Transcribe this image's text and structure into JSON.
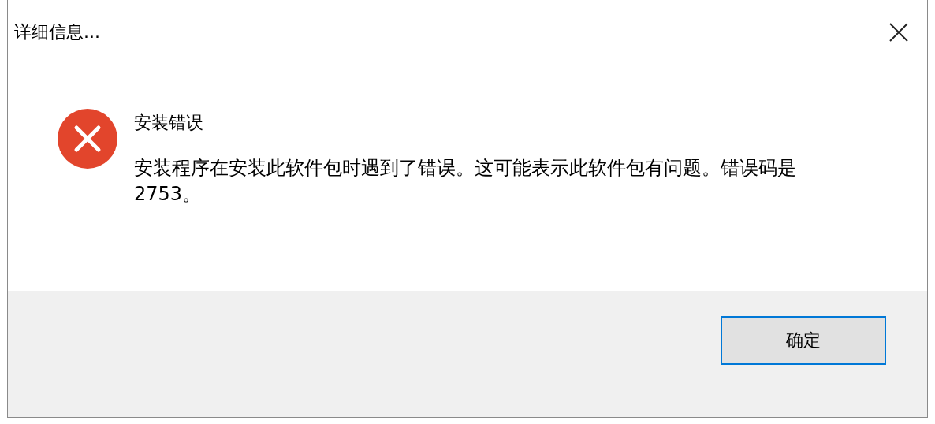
{
  "window": {
    "title": "详细信息..."
  },
  "message": {
    "kind": "error",
    "heading": "安装错误",
    "text": "安装程序在安装此软件包时遇到了错误。这可能表示此软件包有问题。错误码是 2753。"
  },
  "buttons": [
    {
      "label": "确定",
      "selected": true
    }
  ]
}
